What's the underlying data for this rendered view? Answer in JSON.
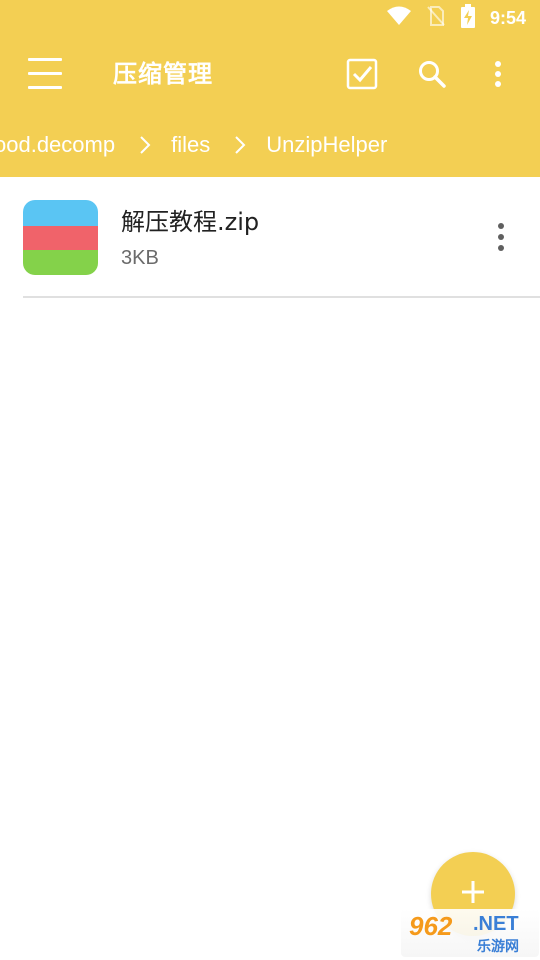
{
  "status_bar": {
    "time": "9:54",
    "icons": [
      "wifi-icon",
      "no-sim-icon",
      "battery-charging-icon"
    ]
  },
  "app_bar": {
    "title": "压缩管理",
    "actions": [
      "select-all-checkbox-icon",
      "search-icon",
      "more-vert-icon"
    ]
  },
  "breadcrumb": {
    "items": [
      {
        "label": "ood.decomp"
      },
      {
        "label": "files"
      },
      {
        "label": "UnzipHelper"
      }
    ]
  },
  "files": [
    {
      "name": "解压教程.zip",
      "size": "3KB",
      "icon": "zip-file-icon"
    }
  ],
  "fab": {
    "icon": "plus-icon"
  },
  "watermark": {
    "number": "962",
    "suffix": ".NET",
    "subtitle": "乐游网"
  },
  "colors": {
    "accent": "#f3cf53",
    "header_text": "#ffffff",
    "primary_text": "#212121",
    "secondary_text": "#6b6b6b"
  }
}
